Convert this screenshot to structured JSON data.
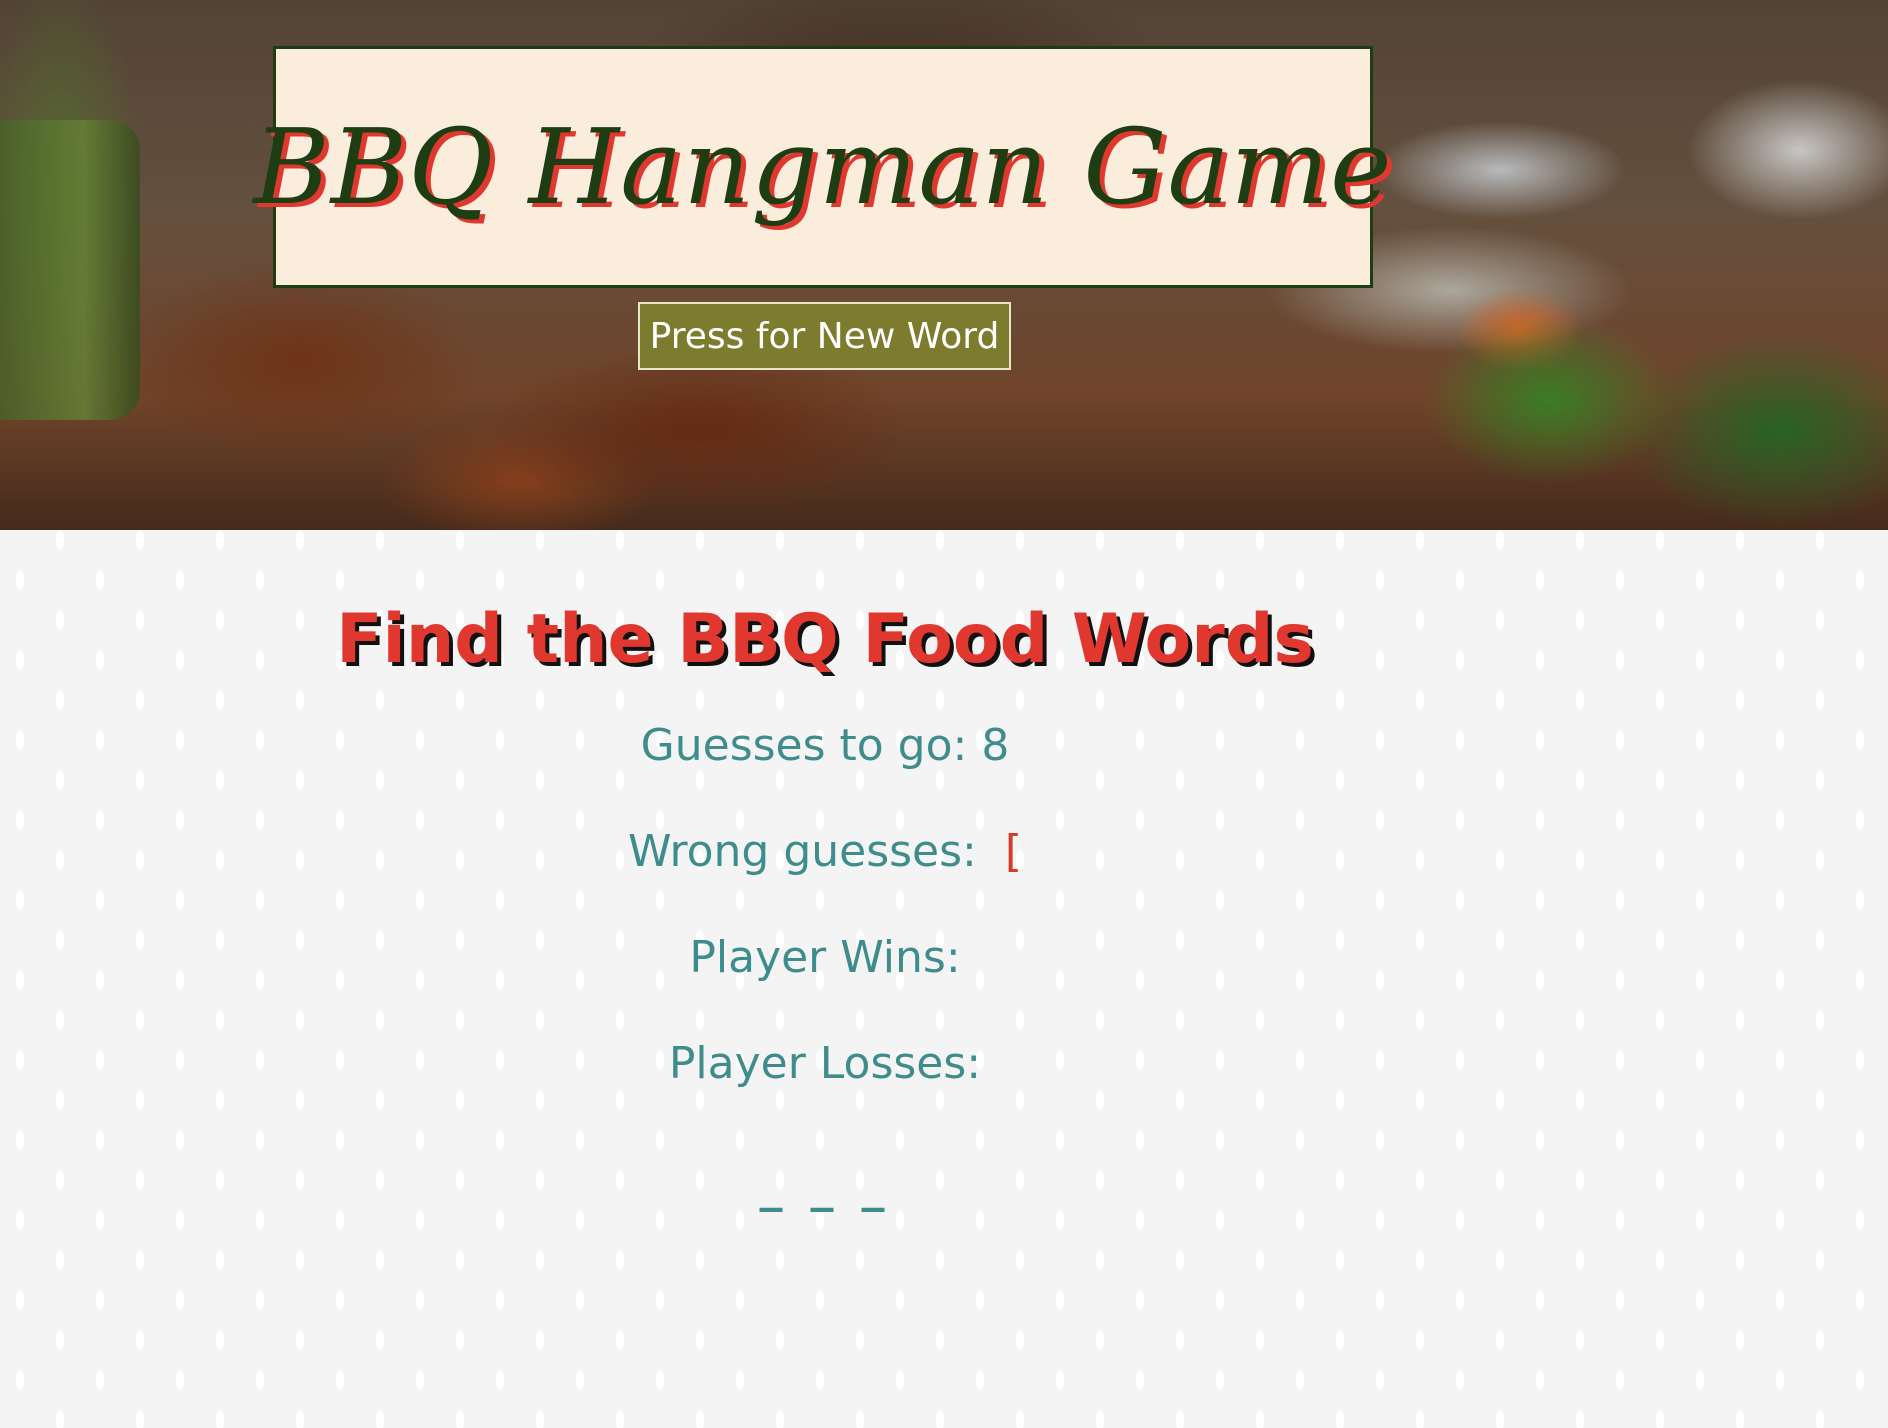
{
  "header": {
    "title": "BBQ Hangman Game",
    "new_word_button": "Press for New Word"
  },
  "main": {
    "heading": "Find the BBQ Food Words",
    "guesses_label": "Guesses to go:",
    "guesses_value": "8",
    "wrong_label": "Wrong guesses:",
    "wrong_value": "[",
    "wins_label": "Player Wins:",
    "wins_value": "",
    "losses_label": "Player Losses:",
    "losses_value": "",
    "word_blanks": "_ _ _"
  },
  "colors": {
    "title_text": "#1f3d12",
    "title_shadow": "#e0382e",
    "title_bg": "#faeddc",
    "button_bg": "#7d7b2d",
    "heading": "#e0382e",
    "stat_text": "#3f8c8c",
    "wrong_text": "#d93b2b"
  }
}
